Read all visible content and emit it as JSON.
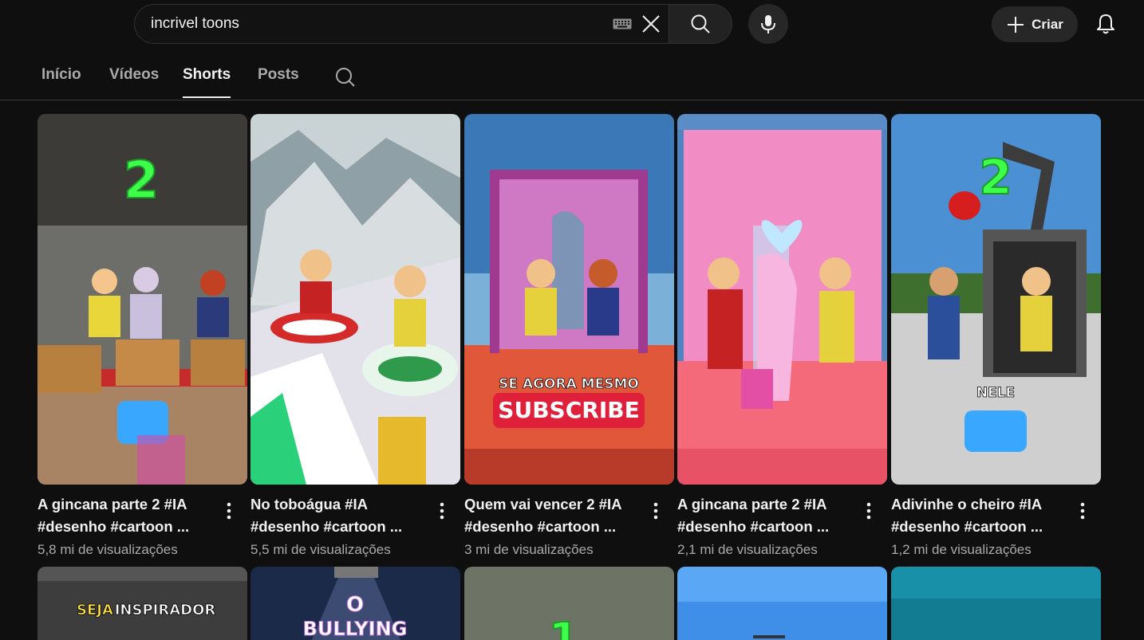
{
  "search": {
    "query": "incrivel toons"
  },
  "header": {
    "create_label": "Criar"
  },
  "tabs": [
    {
      "label": "Início"
    },
    {
      "label": "Vídeos"
    },
    {
      "label": "Shorts"
    },
    {
      "label": "Posts"
    }
  ],
  "shorts": [
    {
      "line1": "A gincana parte 2 #IA",
      "line2": "#desenho #cartoon ...",
      "views": "5,8 mi de visualizações",
      "badge": "2"
    },
    {
      "line1": "No toboágua #IA",
      "line2": "#desenho #cartoon ...",
      "views": "5,5 mi de visualizações"
    },
    {
      "line1": "Quem vai vencer 2 #IA",
      "line2": "#desenho #cartoon ...",
      "views": "3 mi de visualizações",
      "overlay_top": "SE AGORA MESMO",
      "overlay_btn": "SUBSCRIBE"
    },
    {
      "line1": "A gincana parte 2 #IA",
      "line2": "#desenho #cartoon ...",
      "views": "2,1 mi de visualizações"
    },
    {
      "line1": "Adivinhe o cheiro #IA",
      "line2": "#desenho #cartoon ...",
      "views": "1,2 mi de visualizações",
      "badge": "2",
      "overlay": "NELE"
    }
  ],
  "shorts_row2": [
    {
      "overlay_a": "SEJA",
      "overlay_b": "INSPIRADOR"
    },
    {
      "overlay_a": "O",
      "overlay_b": "BULLYING"
    },
    {
      "badge": "1"
    },
    {},
    {}
  ],
  "colors": {
    "background": "#0f0f0f",
    "text": "#f1f1f1",
    "muted": "#aaaaaa",
    "badge_green": "#3dff4a",
    "subscribe_red": "#e0203a"
  }
}
